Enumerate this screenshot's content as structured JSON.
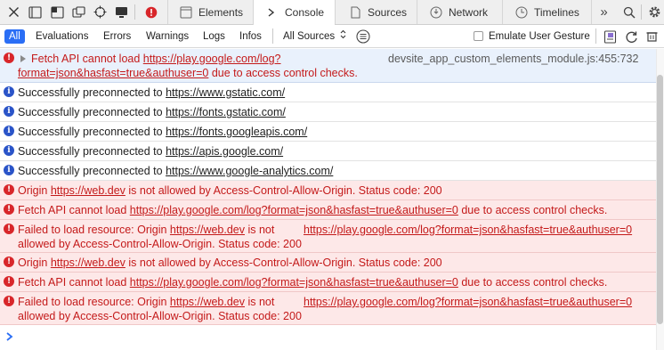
{
  "tabs": [
    {
      "label": "Elements",
      "icon": "elements-icon"
    },
    {
      "label": "Console",
      "icon": "console-icon",
      "active": true
    },
    {
      "label": "Sources",
      "icon": "sources-icon"
    },
    {
      "label": "Network",
      "icon": "network-icon"
    },
    {
      "label": "Timelines",
      "icon": "timelines-icon"
    }
  ],
  "toolbar": {
    "icons": [
      "close-icon",
      "dock-bottom-icon",
      "dock-side-icon",
      "undock-icon",
      "inspect-target-icon",
      "device-icon",
      "error-count-icon"
    ],
    "overflow_label": "»"
  },
  "filters": {
    "all": "All",
    "evaluations": "Evaluations",
    "errors": "Errors",
    "warnings": "Warnings",
    "logs": "Logs",
    "infos": "Infos",
    "sources_select": "All Sources",
    "emulate_label": "Emulate User Gesture",
    "emulate_checked": false
  },
  "messages": {
    "first": {
      "type": "error",
      "prefix": "Fetch API cannot load ",
      "url_part1": "https://play.google.com/log?",
      "url_part2": "format=json&hasfast=true&authuser=0",
      "suffix": " due to access control checks.",
      "source": "devsite_app_custom_elements_module.js:455:732"
    },
    "info": [
      {
        "prefix": "Successfully preconnected to ",
        "url": "https://www.gstatic.com/"
      },
      {
        "prefix": "Successfully preconnected to ",
        "url": "https://fonts.gstatic.com/"
      },
      {
        "prefix": "Successfully preconnected to ",
        "url": "https://fonts.googleapis.com/"
      },
      {
        "prefix": "Successfully preconnected to ",
        "url": "https://apis.google.com/"
      },
      {
        "prefix": "Successfully preconnected to ",
        "url": "https://www.google-analytics.com/"
      }
    ],
    "origin_err": {
      "prefix": "Origin ",
      "url": "https://web.dev",
      "suffix": " is not allowed by Access-Control-Allow-Origin. Status code: 200"
    },
    "fetch_err": {
      "prefix": "Fetch API cannot load ",
      "url": "https://play.google.com/log?format=json&hasfast=true&authuser=0",
      "suffix": " due to access control checks."
    },
    "load_err": {
      "prefix": "Failed to load resource: Origin ",
      "url": "https://web.dev",
      "mid": " is not",
      "line2": "allowed by Access-Control-Allow-Origin. Status code: 200",
      "right_url": "https://play.google.com/log?format=json&hasfast=true&authuser=0"
    }
  },
  "colors": {
    "accent": "#2a6ef5",
    "error_text": "#c41a1a",
    "error_bg": "#fde8e8",
    "info_icon": "#2a54c8",
    "error_icon": "#d8262a"
  }
}
